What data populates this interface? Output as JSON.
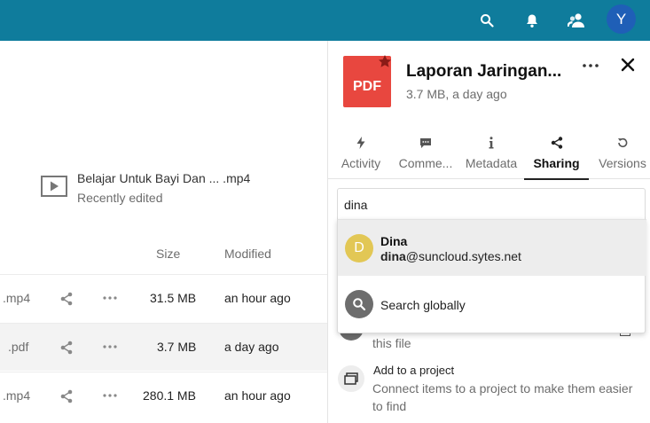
{
  "header": {
    "avatar_initial": "Y",
    "icons": [
      "search-icon",
      "bell-icon",
      "contacts-icon"
    ],
    "bg_color": "#0f7c9c"
  },
  "recent": {
    "name": "Belajar Untuk Bayi Dan ... .mp4",
    "subtitle": "Recently edited"
  },
  "file_table": {
    "columns": {
      "size": "Size",
      "modified": "Modified"
    },
    "rows": [
      {
        "ext": ".mp4",
        "size": "31.5 MB",
        "modified": "an hour ago"
      },
      {
        "ext": ".pdf",
        "size": "3.7 MB",
        "modified": "a day ago"
      },
      {
        "ext": ".mp4",
        "size": "280.1 MB",
        "modified": "an hour ago"
      }
    ]
  },
  "sidebar": {
    "file_type": "PDF",
    "title": "Laporan Jaringan...",
    "subtitle": "3.7 MB, a day ago",
    "tabs": [
      {
        "label": "Activity",
        "icon": "lightning-icon"
      },
      {
        "label": "Comme...",
        "icon": "comment-icon"
      },
      {
        "label": "Metadata",
        "icon": "info-icon"
      },
      {
        "label": "Sharing",
        "icon": "share-icon"
      },
      {
        "label": "Versions",
        "icon": "history-icon"
      }
    ],
    "share_input_value": "dina",
    "suggestions": {
      "user": {
        "initial": "D",
        "name": "Dina",
        "email_match": "dina",
        "email_rest": "@suncloud.sytes.net",
        "avatar_color": "#e2c755"
      },
      "global": {
        "label": "Search globally",
        "avatar_color": "#6d6d6d"
      }
    },
    "partial_text": "this file",
    "project": {
      "title": "Add to a project",
      "description": "Connect items to a project to make them easier to find"
    }
  }
}
